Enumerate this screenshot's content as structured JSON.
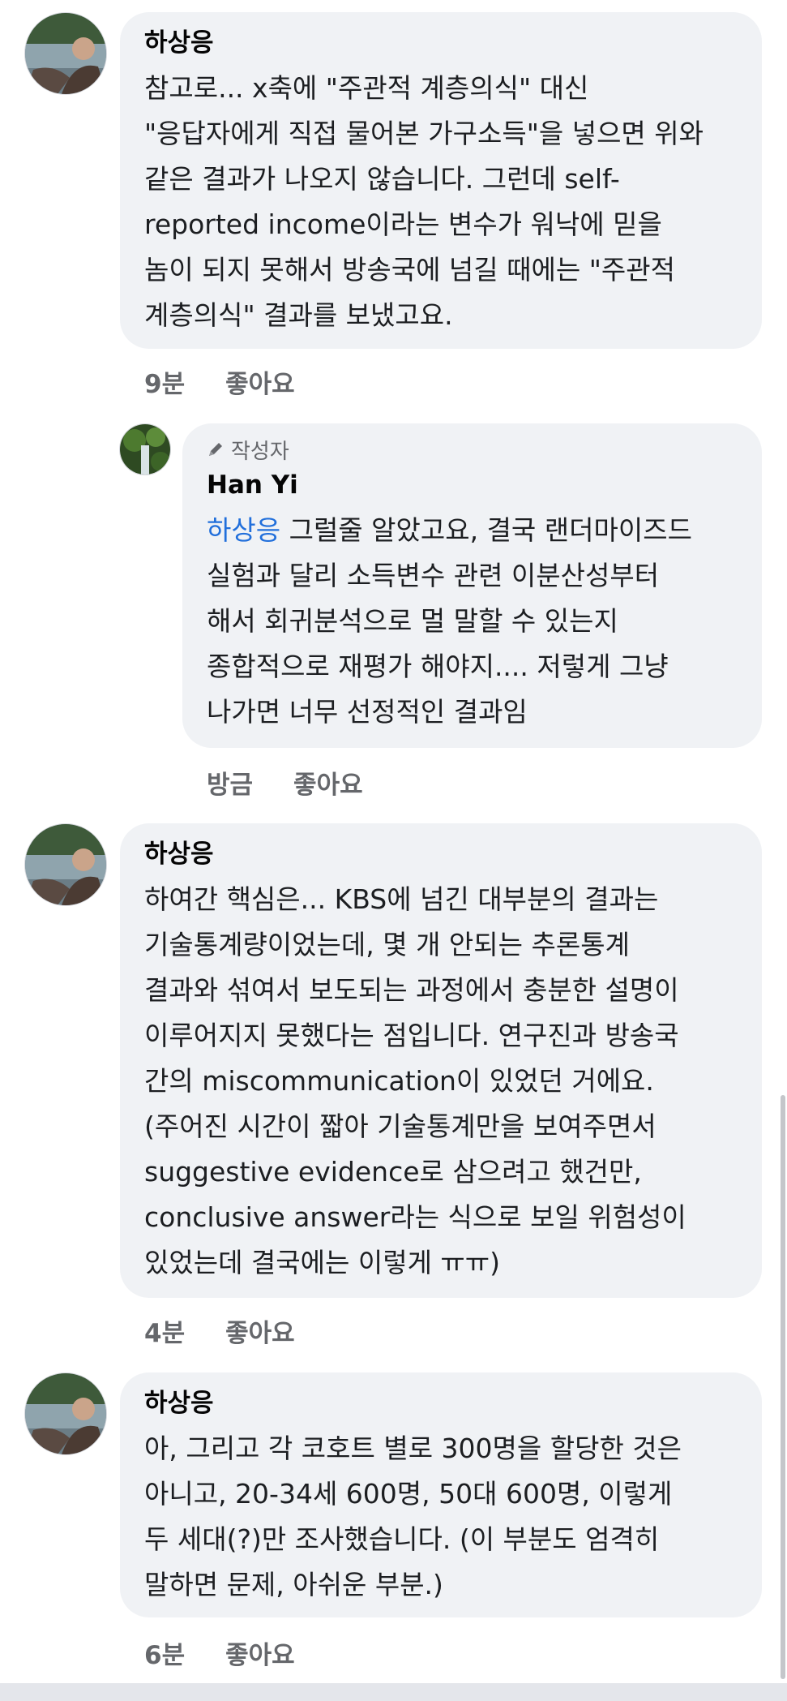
{
  "comments": [
    {
      "author": "하상응",
      "text": "참고로... x축에 \"주관적 계층의식\" 대신\n\"응답자에게 직접 물어본 가구소득\"을 넣으면 위와\n같은 결과가 나오지 않습니다. 그런데 self-\nreported income이라는 변수가 워낙에 믿을\n놈이 되지 못해서 방송국에 넘길 때에는 \"주관적\n계층의식\" 결과를 보냈고요.",
      "time": "9분",
      "like": "좋아요"
    },
    {
      "badge": "작성자",
      "author": "Han Yi",
      "mention": "하상응",
      "text": " 그럴줄 알았고요, 결국 랜더마이즈드\n실험과 달리 소득변수 관련 이분산성부터\n해서 회귀분석으로 멀 말할 수 있는지\n종합적으로 재평가 해야지.... 저렇게 그냥\n나가면 너무 선정적인 결과임",
      "time": "방금",
      "like": "좋아요"
    },
    {
      "author": "하상응",
      "text": "하여간 핵심은... KBS에 넘긴 대부분의 결과는\n기술통계량이었는데, 몇 개 안되는 추론통계\n결과와 섞여서 보도되는 과정에서 충분한 설명이\n이루어지지 못했다는 점입니다. 연구진과 방송국\n간의 miscommunication이 있었던 거에요.\n(주어진 시간이 짧아 기술통계만을 보여주면서\nsuggestive evidence로 삼으려고 했건만,\nconclusive answer라는 식으로 보일 위험성이\n있었는데 결국에는 이렇게 ㅠㅠ)",
      "time": "4분",
      "like": "좋아요"
    },
    {
      "author": "하상응",
      "text": "아, 그리고 각 코호트 별로 300명을 할당한 것은\n아니고, 20-34세 600명, 50대 600명, 이렇게\n두 세대(?)만 조사했습니다. (이 부분도 엄격히\n말하면 문제, 아쉬운 부분.)",
      "time": "6분",
      "like": "좋아요"
    }
  ],
  "icons": {
    "author_badge": "pencil-icon"
  },
  "colors": {
    "bubble": "#f0f2f5",
    "mention": "#216fdb",
    "meta": "#65676b"
  }
}
